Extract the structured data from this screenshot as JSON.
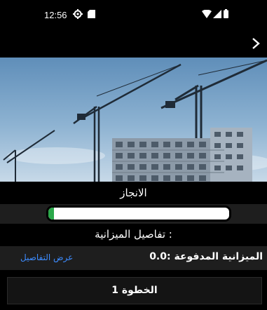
{
  "status_bar": {
    "time": "12:56",
    "icons": [
      "gear-icon",
      "sd-card-icon",
      "wifi-icon",
      "signal-icon",
      "battery-icon"
    ]
  },
  "app_bar": {
    "back_icon": "chevron-right-icon"
  },
  "hero": {
    "image": "construction-cranes-building-photo"
  },
  "progress": {
    "title": "الانجاز",
    "value_percent": 3,
    "fill_color": "#2ba84a"
  },
  "budget": {
    "title": "تفاصيل الميزانية :",
    "paid_label": "الميزانية المدفوعة :",
    "paid_value": "0.0",
    "details_link": "عرض التفاصيل",
    "link_color": "#3d8cff"
  },
  "step": {
    "label": "الخطوة 1"
  }
}
